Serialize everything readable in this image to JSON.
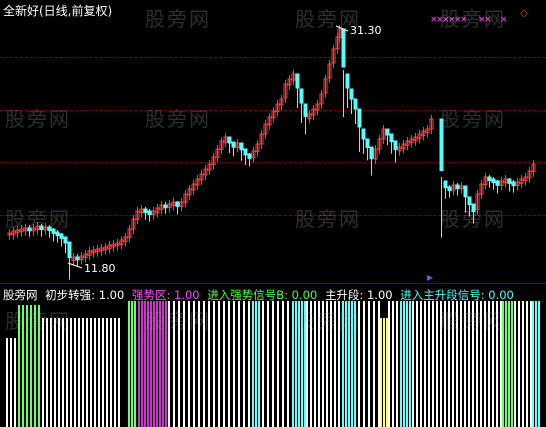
{
  "chart_title": "全新好(日线,前复权)",
  "price_annotations": {
    "high_label": "31.30",
    "low_label": "11.80"
  },
  "watermark_text": "股旁网",
  "indicator_legend": {
    "name": "股旁网",
    "items": [
      {
        "label": "初步转强",
        "value": "1.00",
        "color": "#ffffff"
      },
      {
        "label": "强势区",
        "value": "1.00",
        "color": "#ff44ff"
      },
      {
        "label": "进入强势信号B",
        "value": "0.00",
        "color": "#44ff44"
      },
      {
        "label": "主升段",
        "value": "1.00",
        "color": "#ffffff"
      },
      {
        "label": "进入主升段信号",
        "value": "0.00",
        "color": "#44ffff"
      }
    ]
  },
  "colors": {
    "up_candle": "#ff3b3b",
    "down_candle": "#55ffff",
    "grid": "#7a0000",
    "magenta_bars": "#cc33cc",
    "green_bars": "#66ff66",
    "cyan_bars": "#66ffff",
    "white_bars": "#ffffff",
    "yellow_bars": "#ffff66"
  }
}
